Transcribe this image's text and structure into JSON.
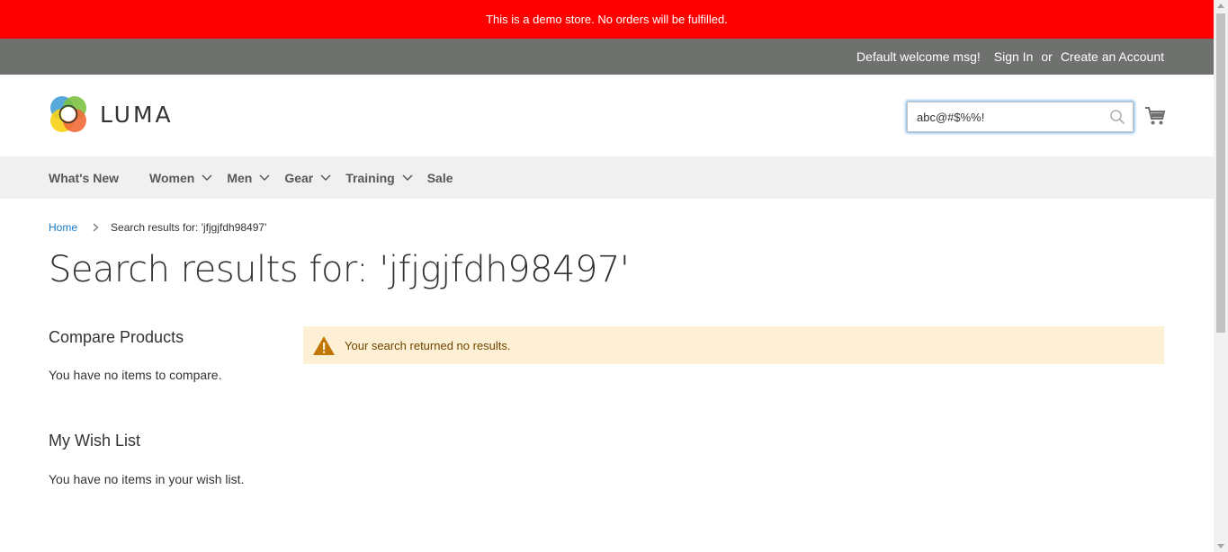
{
  "banner": {
    "text": "This is a demo store. No orders will be fulfilled."
  },
  "top_links": {
    "welcome": "Default welcome msg!",
    "sign_in": "Sign In",
    "or": "or",
    "create_account": "Create an Account"
  },
  "header": {
    "logo_text": "LUMA",
    "search_value": "abc@#$%%!",
    "cart_icon": "cart-icon",
    "search_icon": "search-icon"
  },
  "nav": {
    "items": [
      {
        "label": "What's New",
        "has_dropdown": false
      },
      {
        "label": "Women",
        "has_dropdown": true
      },
      {
        "label": "Men",
        "has_dropdown": true
      },
      {
        "label": "Gear",
        "has_dropdown": true
      },
      {
        "label": "Training",
        "has_dropdown": true
      },
      {
        "label": "Sale",
        "has_dropdown": false
      }
    ]
  },
  "breadcrumb": {
    "home": "Home",
    "current": "Search results for: 'jfjgjfdh98497'"
  },
  "page_title": "Search results for: 'jfjgjfdh98497'",
  "sidebar": {
    "compare_title": "Compare Products",
    "compare_text": "You have no items to compare.",
    "wishlist_title": "My Wish List",
    "wishlist_text": "You have no items in your wish list."
  },
  "message": {
    "icon": "warning-icon",
    "text": "Your search returned no results."
  },
  "colors": {
    "banner": "#ff0000",
    "top_bar": "#6e716e",
    "nav_bg": "#f0f0f0",
    "link": "#1979c3",
    "notice_bg": "#fdf0d5",
    "notice_icon": "#c07600"
  }
}
